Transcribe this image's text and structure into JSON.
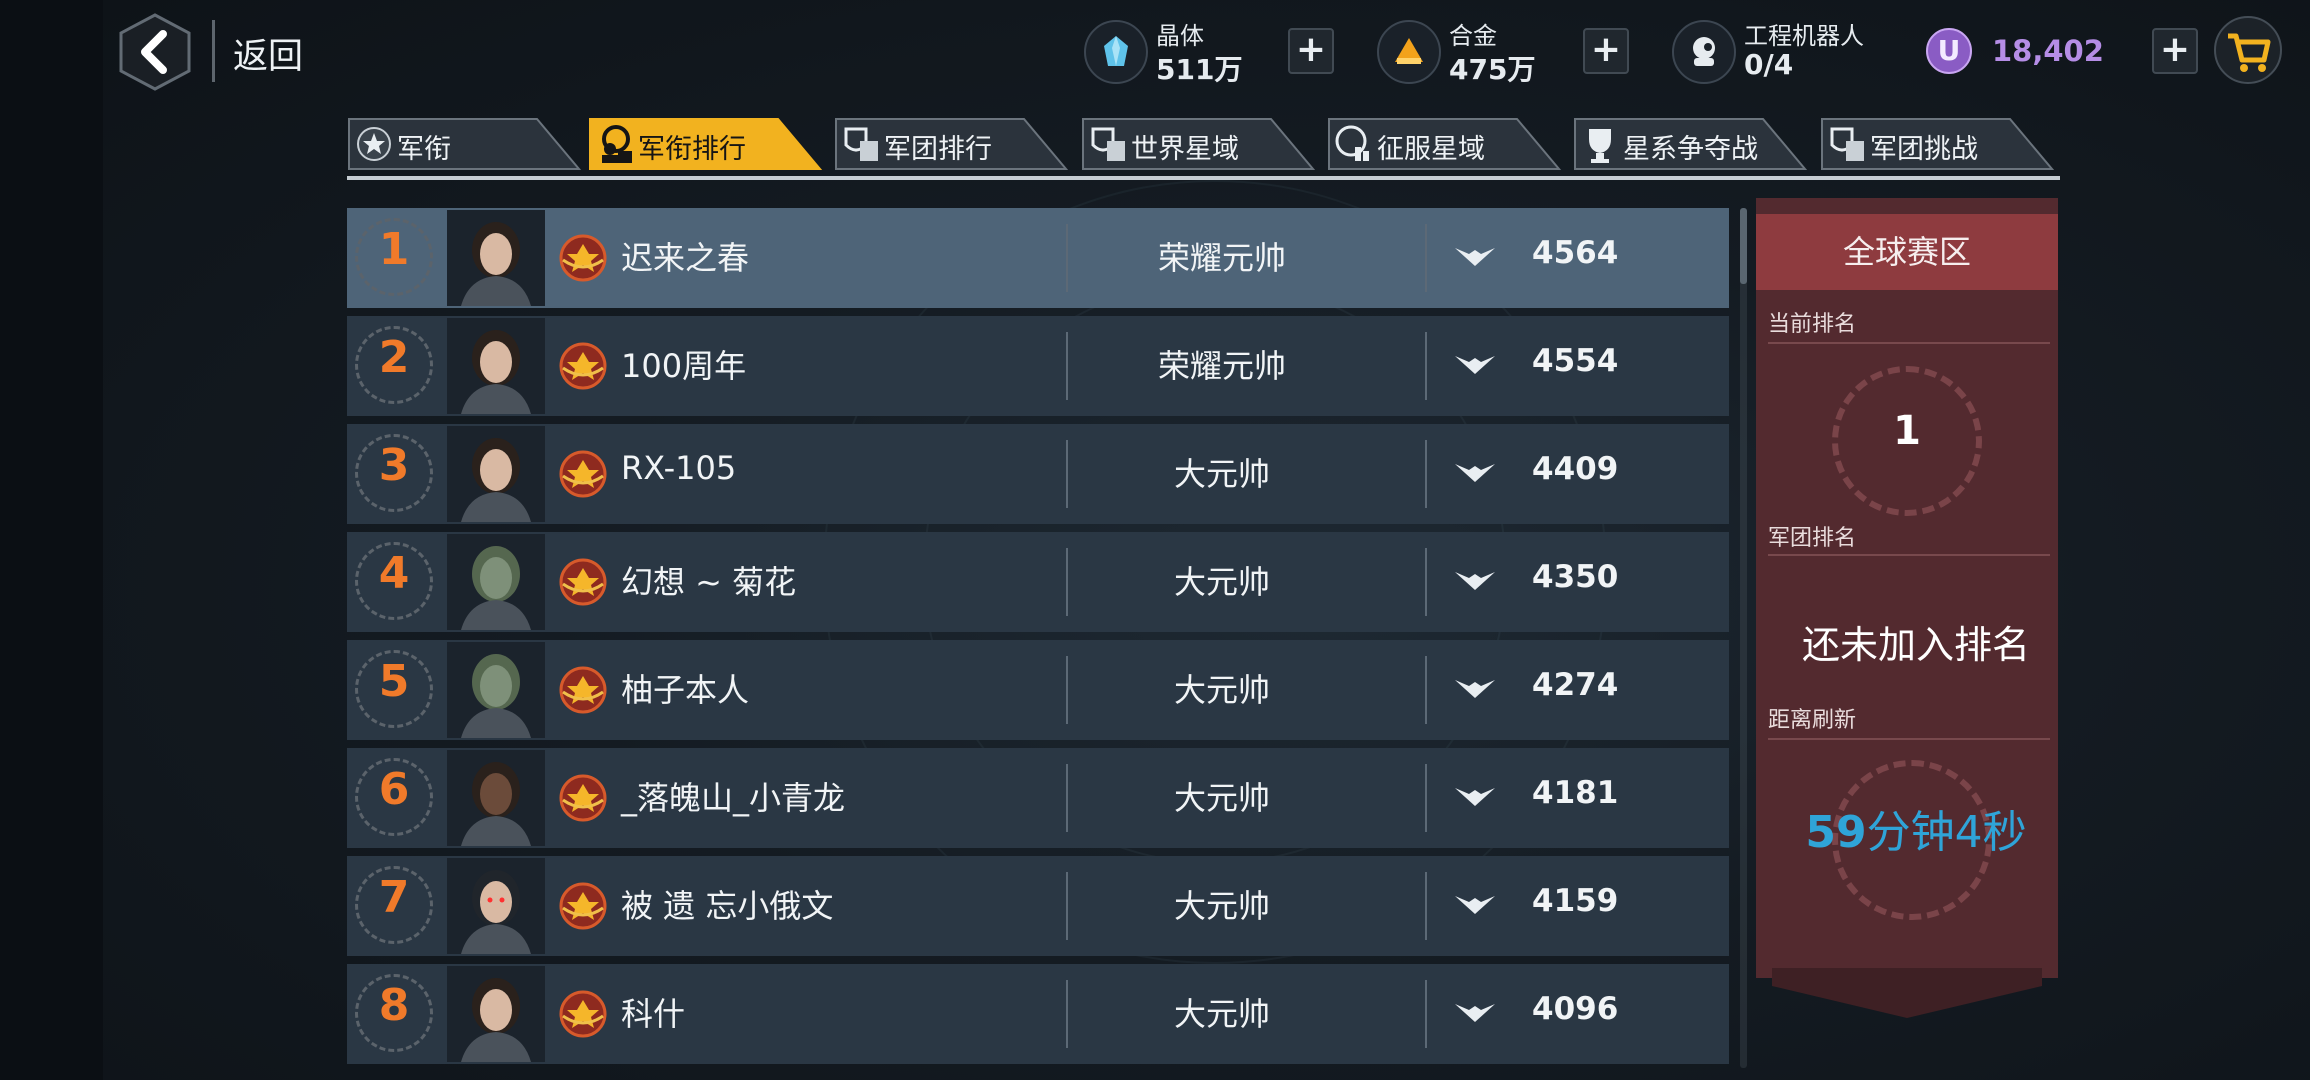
{
  "header": {
    "back_label": "返回",
    "resources": [
      {
        "name": "晶体",
        "value": "511万",
        "icon": "crystal-icon",
        "color": "#5fc3ea"
      },
      {
        "name": "合金",
        "value": "475万",
        "icon": "alloy-icon",
        "color": "#f2a21b"
      },
      {
        "name": "工程机器人",
        "value": "0/4",
        "icon": "robot-icon",
        "color": "#e6ebef"
      }
    ],
    "currency": {
      "value": "18,402",
      "symbol": "U",
      "color": "#b58de6"
    },
    "plus_label": "+"
  },
  "tabs": [
    {
      "label": "军衔",
      "active": false,
      "icon": "rank-emblem-icon"
    },
    {
      "label": "军衔排行",
      "active": true,
      "icon": "rank-leaderboard-icon"
    },
    {
      "label": "军团排行",
      "active": false,
      "icon": "legion-ranking-icon"
    },
    {
      "label": "世界星域",
      "active": false,
      "icon": "world-starfield-icon"
    },
    {
      "label": "征服星域",
      "active": false,
      "icon": "conquer-starfield-icon"
    },
    {
      "label": "星系争夺战",
      "active": false,
      "icon": "trophy-icon"
    },
    {
      "label": "军团挑战",
      "active": false,
      "icon": "legion-challenge-icon"
    }
  ],
  "ranking": [
    {
      "rank": "1",
      "name": "迟来之春",
      "title": "荣耀元帅",
      "score": "4564",
      "avatar": "female-pilot-avatar"
    },
    {
      "rank": "2",
      "name": "100周年",
      "title": "荣耀元帅",
      "score": "4554",
      "avatar": "female-pilot-avatar"
    },
    {
      "rank": "3",
      "name": "RX-105",
      "title": "大元帅",
      "score": "4409",
      "avatar": "male-officer-avatar"
    },
    {
      "rank": "4",
      "name": "幻想 ~ 菊花",
      "title": "大元帅",
      "score": "4350",
      "avatar": "alien-avatar"
    },
    {
      "rank": "5",
      "name": "柚子本人",
      "title": "大元帅",
      "score": "4274",
      "avatar": "alien-avatar"
    },
    {
      "rank": "6",
      "name": "_落魄山_小青龙",
      "title": "大元帅",
      "score": "4181",
      "avatar": "bald-soldier-avatar"
    },
    {
      "rank": "7",
      "name": "被 遗 忘小俄文",
      "title": "大元帅",
      "score": "4159",
      "avatar": "hooded-avatar"
    },
    {
      "rank": "8",
      "name": "科什",
      "title": "大元帅",
      "score": "4096",
      "avatar": "bearded-soldier-avatar"
    }
  ],
  "panel": {
    "region": "全球赛区",
    "current_rank_label": "当前排名",
    "current_rank_value": "1",
    "legion_rank_label": "军团排名",
    "legion_rank_value": "还未加入排名",
    "refresh_label": "距离刷新",
    "refresh_minutes": "59",
    "refresh_rest": "分钟4秒"
  },
  "colors": {
    "accent_orange": "#f07a2a",
    "tab_active": "#f2b21f",
    "timer_blue": "#2fa4d8",
    "panel_red": "#8e3b3f"
  }
}
